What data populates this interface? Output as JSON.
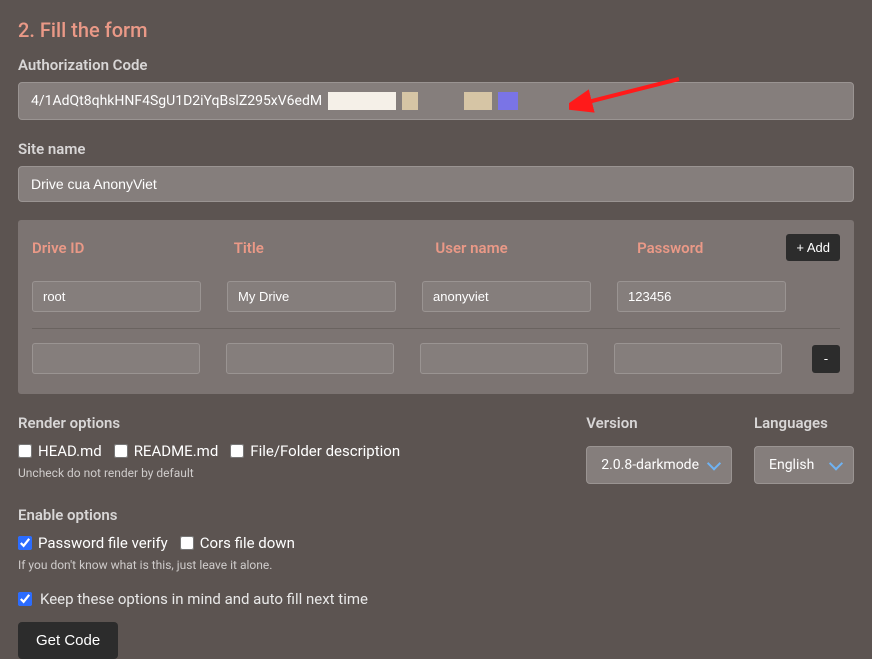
{
  "heading": "2. Fill the form",
  "auth": {
    "label": "Authorization Code",
    "value": "4/1AdQt8qhkHNF4SgU1D2iYqBslZ295xV6edM"
  },
  "site": {
    "label": "Site name",
    "value": "Drive cua AnonyViet"
  },
  "drives": {
    "headers": {
      "id": "Drive ID",
      "title": "Title",
      "user": "User name",
      "pass": "Password"
    },
    "add_label": "+ Add",
    "remove_label": "-",
    "rows": [
      {
        "id": "root",
        "title": "My Drive",
        "user": "anonyviet",
        "pass": "123456"
      },
      {
        "id": "",
        "title": "",
        "user": "",
        "pass": ""
      }
    ]
  },
  "render": {
    "heading": "Render options",
    "head_md": "HEAD.md",
    "readme_md": "README.md",
    "file_desc": "File/Folder description",
    "hint": "Uncheck do not render by default"
  },
  "version": {
    "label": "Version",
    "value": "2.0.8-darkmode"
  },
  "languages": {
    "label": "Languages",
    "value": "English"
  },
  "enable": {
    "heading": "Enable options",
    "pw_verify": "Password file verify",
    "cors": "Cors file down",
    "hint": "If you don't know what is this, just leave it alone."
  },
  "keep_opts": "Keep these options in mind and auto fill next time",
  "get_code": "Get Code"
}
